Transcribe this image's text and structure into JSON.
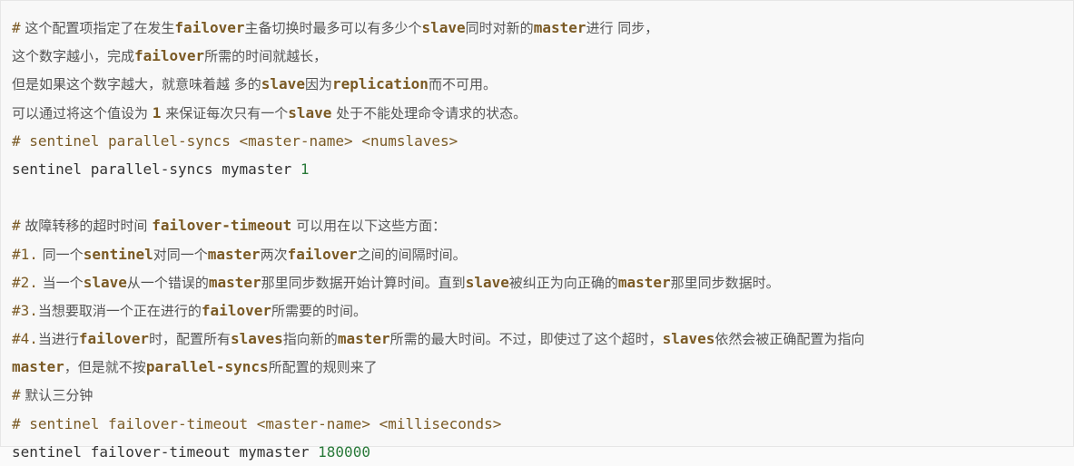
{
  "lines": [
    {
      "type": "comment",
      "parts": [
        [
          "#",
          ""
        ],
        [
          " 这个配置项指定了在发生",
          "cn"
        ],
        [
          "failover",
          "kw"
        ],
        [
          "主备切换时最多可以有多少个",
          "cn"
        ],
        [
          "slave",
          "kw"
        ],
        [
          "同时对新的",
          "cn"
        ],
        [
          "master",
          "kw"
        ],
        [
          "进行 同步，",
          "cn"
        ]
      ]
    },
    {
      "type": "comment",
      "parts": [
        [
          "这个数字越小，完成",
          "cn"
        ],
        [
          "failover",
          "kw"
        ],
        [
          "所需的时间就越长，",
          "cn"
        ]
      ]
    },
    {
      "type": "comment",
      "parts": [
        [
          "但是如果这个数字越大，就意味着越 多的",
          "cn"
        ],
        [
          "slave",
          "kw"
        ],
        [
          "因为",
          "cn"
        ],
        [
          "replication",
          "kw"
        ],
        [
          "而不可用。",
          "cn"
        ]
      ]
    },
    {
      "type": "comment",
      "parts": [
        [
          "可以通过将这个值设为 ",
          "cn"
        ],
        [
          "1",
          "kw"
        ],
        [
          " 来保证每次只有一个",
          "cn"
        ],
        [
          "slave",
          "kw"
        ],
        [
          " 处于不能处理命令请求的状态。",
          "cn"
        ]
      ]
    },
    {
      "type": "comment",
      "parts": [
        [
          "# sentinel parallel-syncs <master-name> <numslaves>",
          ""
        ]
      ]
    },
    {
      "type": "code",
      "text": "sentinel parallel-syncs mymaster ",
      "num": "1"
    },
    {
      "type": "blank"
    },
    {
      "type": "comment",
      "parts": [
        [
          "#",
          ""
        ],
        [
          " 故障转移的超时时间 ",
          "cn"
        ],
        [
          "failover-timeout",
          "kw"
        ],
        [
          " 可以用在以下这些方面：",
          "cn"
        ]
      ]
    },
    {
      "type": "comment",
      "parts": [
        [
          "#1.",
          ""
        ],
        [
          " 同一个",
          "cn"
        ],
        [
          "sentinel",
          "kw"
        ],
        [
          "对同一个",
          "cn"
        ],
        [
          "master",
          "kw"
        ],
        [
          "两次",
          "cn"
        ],
        [
          "failover",
          "kw"
        ],
        [
          "之间的间隔时间。",
          "cn"
        ]
      ]
    },
    {
      "type": "comment",
      "parts": [
        [
          "#2.",
          ""
        ],
        [
          " 当一个",
          "cn"
        ],
        [
          "slave",
          "kw"
        ],
        [
          "从一个错误的",
          "cn"
        ],
        [
          "master",
          "kw"
        ],
        [
          "那里同步数据开始计算时间。直到",
          "cn"
        ],
        [
          "slave",
          "kw"
        ],
        [
          "被纠正为向正确的",
          "cn"
        ],
        [
          "master",
          "kw"
        ],
        [
          "那里同步数据时。",
          "cn"
        ]
      ]
    },
    {
      "type": "comment",
      "parts": [
        [
          "#3.",
          ""
        ],
        [
          "当想要取消一个正在进行的",
          "cn"
        ],
        [
          "failover",
          "kw"
        ],
        [
          "所需要的时间。",
          "cn"
        ]
      ]
    },
    {
      "type": "comment",
      "parts": [
        [
          "#4.",
          ""
        ],
        [
          "当进行",
          "cn"
        ],
        [
          "failover",
          "kw"
        ],
        [
          "时，配置所有",
          "cn"
        ],
        [
          "slaves",
          "kw"
        ],
        [
          "指向新的",
          "cn"
        ],
        [
          "master",
          "kw"
        ],
        [
          "所需的最大时间。不过，即使过了这个超时，",
          "cn"
        ],
        [
          "slaves",
          "kw"
        ],
        [
          "依然会被正确配置为指向",
          "cn"
        ]
      ]
    },
    {
      "type": "comment",
      "parts": [
        [
          "master",
          "kw"
        ],
        [
          "，但是就不按",
          "cn"
        ],
        [
          "parallel-syncs",
          "kw"
        ],
        [
          "所配置的规则来了",
          "cn"
        ]
      ]
    },
    {
      "type": "comment",
      "parts": [
        [
          "#",
          ""
        ],
        [
          " 默认三分钟",
          "cn"
        ]
      ]
    },
    {
      "type": "comment",
      "parts": [
        [
          "# sentinel failover-timeout <master-name> <milliseconds>",
          ""
        ]
      ]
    },
    {
      "type": "code",
      "text": "sentinel failover-timeout mymaster ",
      "num": "180000"
    }
  ]
}
